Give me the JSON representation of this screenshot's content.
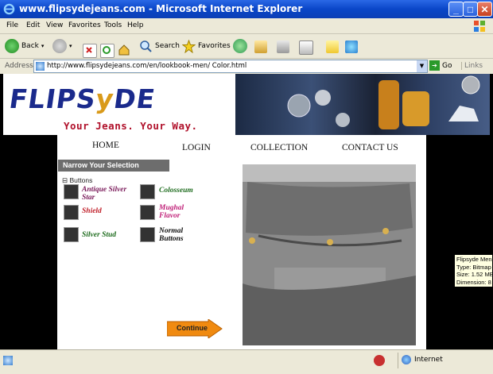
{
  "window": {
    "title": "www.flipsydejeans.com - Microsoft Internet Explorer"
  },
  "menu": {
    "items": [
      "File",
      "Edit",
      "View",
      "Favorites",
      "Tools",
      "Help"
    ]
  },
  "toolbar": {
    "back": "Back",
    "search": "Search",
    "favorites": "Favorites"
  },
  "address": {
    "label": "Address",
    "url": "http://www.flipsydejeans.com/en/lookbook-men/ Color.html",
    "go": "Go",
    "links": "Links"
  },
  "site": {
    "logo_pre": "FLIPS",
    "logo_y": "y",
    "logo_post": "DE",
    "tagline": "Your Jeans. Your Way.",
    "nav": {
      "home": "HOME",
      "login": "LOGIN",
      "collection": "COLLECTION",
      "contact": "CONTACT US"
    },
    "narrow": "Narrow Your Selection",
    "buttons_label": "Buttons",
    "items": [
      {
        "label": "Antique Silver Star",
        "color": "#7a1a5a"
      },
      {
        "label": "Colosseum",
        "color": "#1d6b1d"
      },
      {
        "label": "Shield",
        "color": "#c0202a"
      },
      {
        "label": "Mughal Flavor",
        "color": "#c02078"
      },
      {
        "label": "Silver Stud",
        "color": "#1d6b1d"
      },
      {
        "label": "Normal Buttons",
        "color": "#111111"
      }
    ],
    "continue": "Continue"
  },
  "tooltip": {
    "lines": [
      "Flipsyde Men'",
      "Type: Bitmap",
      "Size: 1.52 MB",
      "Dimension: 8"
    ]
  },
  "status": {
    "zone": "Internet"
  }
}
